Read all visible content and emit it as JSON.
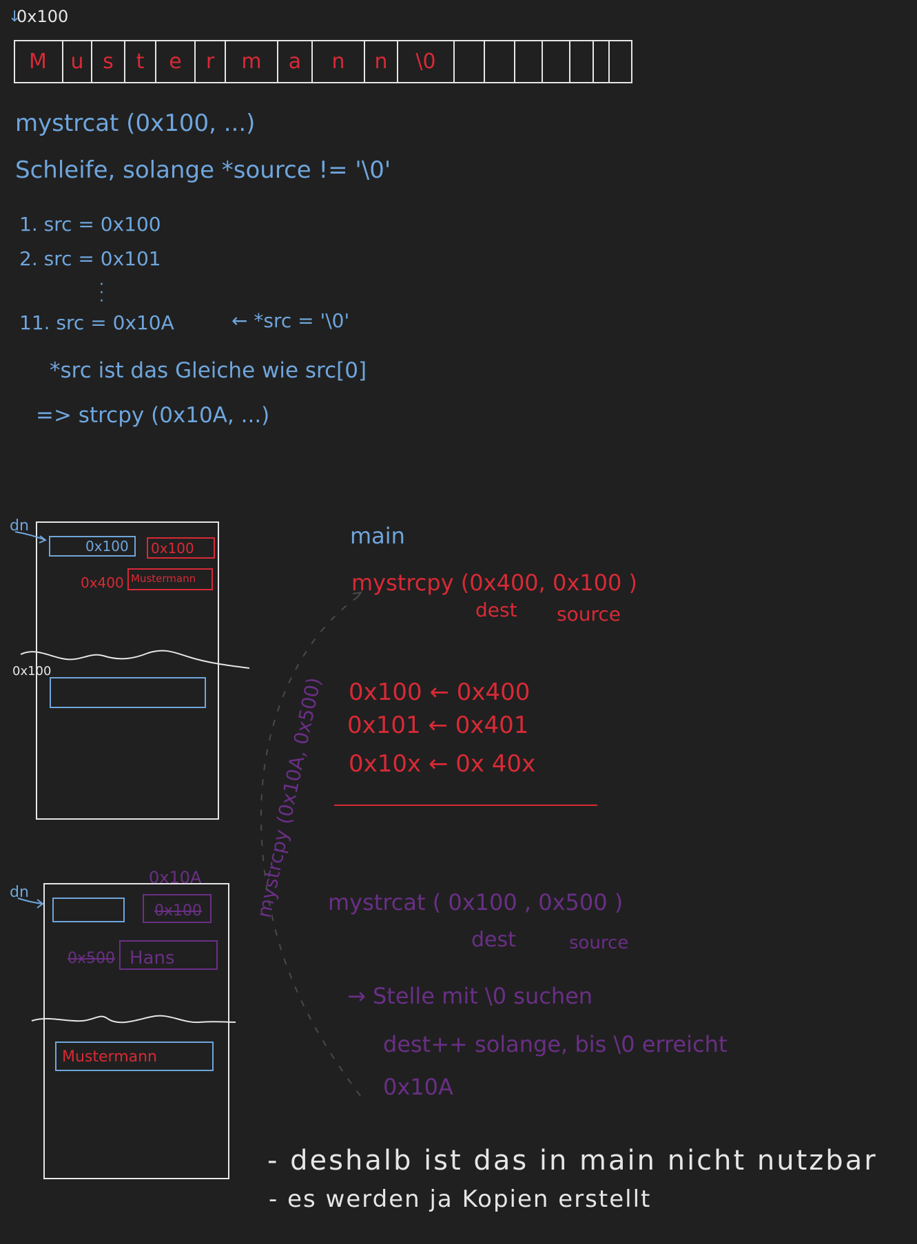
{
  "top": {
    "address_label": "0x100",
    "cells": [
      "M",
      "u",
      "s",
      "t",
      "e",
      "r",
      "m",
      "a",
      "n",
      "n",
      "\\0",
      "",
      "",
      "",
      "",
      "",
      "",
      ""
    ],
    "call": "mystrcat (0x100, ...)",
    "loop": "Schleife, solange *source != '\\0'",
    "steps": [
      "1.  src = 0x100",
      "2.  src = 0x101",
      "11. src = 0x10A"
    ],
    "step_note": "← *src = '\\0'",
    "deref_note": "*src ist das Gleiche wie src[0]",
    "result": "=> strcpy (0x10A, ...)"
  },
  "frame1": {
    "label": "dn",
    "pointer_blue": "0x100",
    "pointer_red": "0x100",
    "heap_addr": "0x400",
    "heap_value": "Mustermann",
    "lower_addr": "0x100"
  },
  "main_block": {
    "title": "main",
    "call": "mystrcpy (0x400, 0x100 )",
    "param_dest": "dest",
    "param_source": "source",
    "copies": [
      "0x100  ←  0x400",
      "0x101  ←  0x401",
      "0x10x  ←  0x 40x"
    ]
  },
  "frame2": {
    "label": "dn",
    "new_pointer": "0x10A",
    "old_pointer": "0x100",
    "heap_addr": "0x500",
    "heap_value": "Hans",
    "lower_value": "Mustermann"
  },
  "vertical_call": "mystrcpy (0x10A, 0x500)",
  "cat_block": {
    "call": "mystrcat ( 0x100 , 0x500 )",
    "param_dest": "dest",
    "param_source": "source",
    "step1": "→ Stelle mit \\0 suchen",
    "step2": "dest++ solange, bis \\0 erreicht",
    "step3": "0x10A"
  },
  "conclusion": [
    "- deshalb ist das in main nicht nutzbar",
    "- es werden ja Kopien erstellt"
  ],
  "colors": {
    "background": "#202020",
    "white": "#e6e6e6",
    "blue": "#6fa6dd",
    "red": "#d82a36",
    "purple": "#6a2f86"
  }
}
